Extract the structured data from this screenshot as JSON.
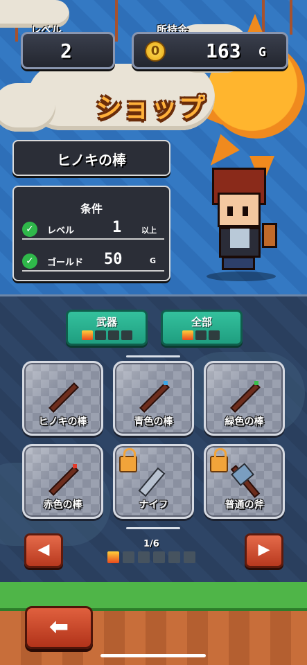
{
  "hud": {
    "level_label": "レベル",
    "level_value": "2",
    "gold_label": "所持金",
    "gold_value": "163",
    "gold_unit": "G",
    "coin_glyph": "0"
  },
  "title": "ショップ",
  "selected_item": {
    "name": "ヒノキの棒",
    "conditions_header": "条件",
    "conditions": [
      {
        "label": "レベル",
        "value": "1",
        "unit": "以上",
        "met": true
      },
      {
        "label": "ゴールド",
        "value": "50",
        "unit": "G",
        "met": true
      }
    ]
  },
  "categories": [
    {
      "label": "武器",
      "progress": [
        1,
        0,
        0,
        0
      ]
    },
    {
      "label": "全部",
      "progress": [
        1,
        0,
        0
      ]
    }
  ],
  "items": [
    {
      "name": "ヒノキの棒",
      "locked": false,
      "tip_color": "#6d2d1d"
    },
    {
      "name": "青色の棒",
      "locked": false,
      "tip_color": "#3aa7e8"
    },
    {
      "name": "緑色の棒",
      "locked": false,
      "tip_color": "#39c04a"
    },
    {
      "name": "赤色の棒",
      "locked": false,
      "tip_color": "#e23a2a"
    },
    {
      "name": "ナイフ",
      "locked": true,
      "tip_color": "#9aa4b4"
    },
    {
      "name": "普通の斧",
      "locked": true,
      "tip_color": "#7a9ec0"
    }
  ],
  "pager": {
    "label": "1/6",
    "pages": 6,
    "current": 1
  },
  "icons": {
    "prev": "left-arrow-icon",
    "next": "right-arrow-icon",
    "back": "back-arrow-icon",
    "check": "check-icon",
    "lock": "lock-icon",
    "coin": "coin-icon"
  }
}
